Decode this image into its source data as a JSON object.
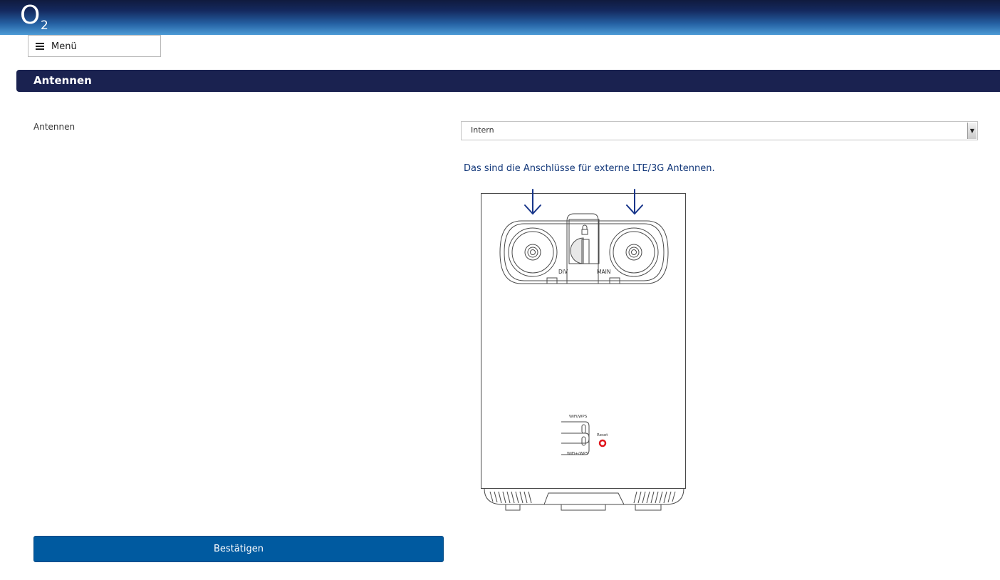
{
  "header": {
    "logo_icon": "o2-logo",
    "logo_text": "O",
    "logo_subscript": "2"
  },
  "menu": {
    "label": "Menü",
    "icon": "hamburger-icon"
  },
  "section": {
    "title": "Antennen"
  },
  "form": {
    "antenna_label": "Antennen",
    "antenna_select_value": "Intern",
    "antenna_info": "Das sind die Anschlüsse für externe LTE/3G Antennen."
  },
  "diagram": {
    "port_left_label": "DIV",
    "port_right_label": "MAIN",
    "wifi_wps_label": "WiFi/WPS",
    "wifi_plus_label": "WiFi+/WPS",
    "reset_label": "Reset"
  },
  "actions": {
    "confirm_label": "Bestätigen"
  },
  "colors": {
    "header_navy": "#1a2250",
    "button_blue": "#005aa0",
    "info_text_blue": "#13387a",
    "reset_red": "#e0151b"
  }
}
